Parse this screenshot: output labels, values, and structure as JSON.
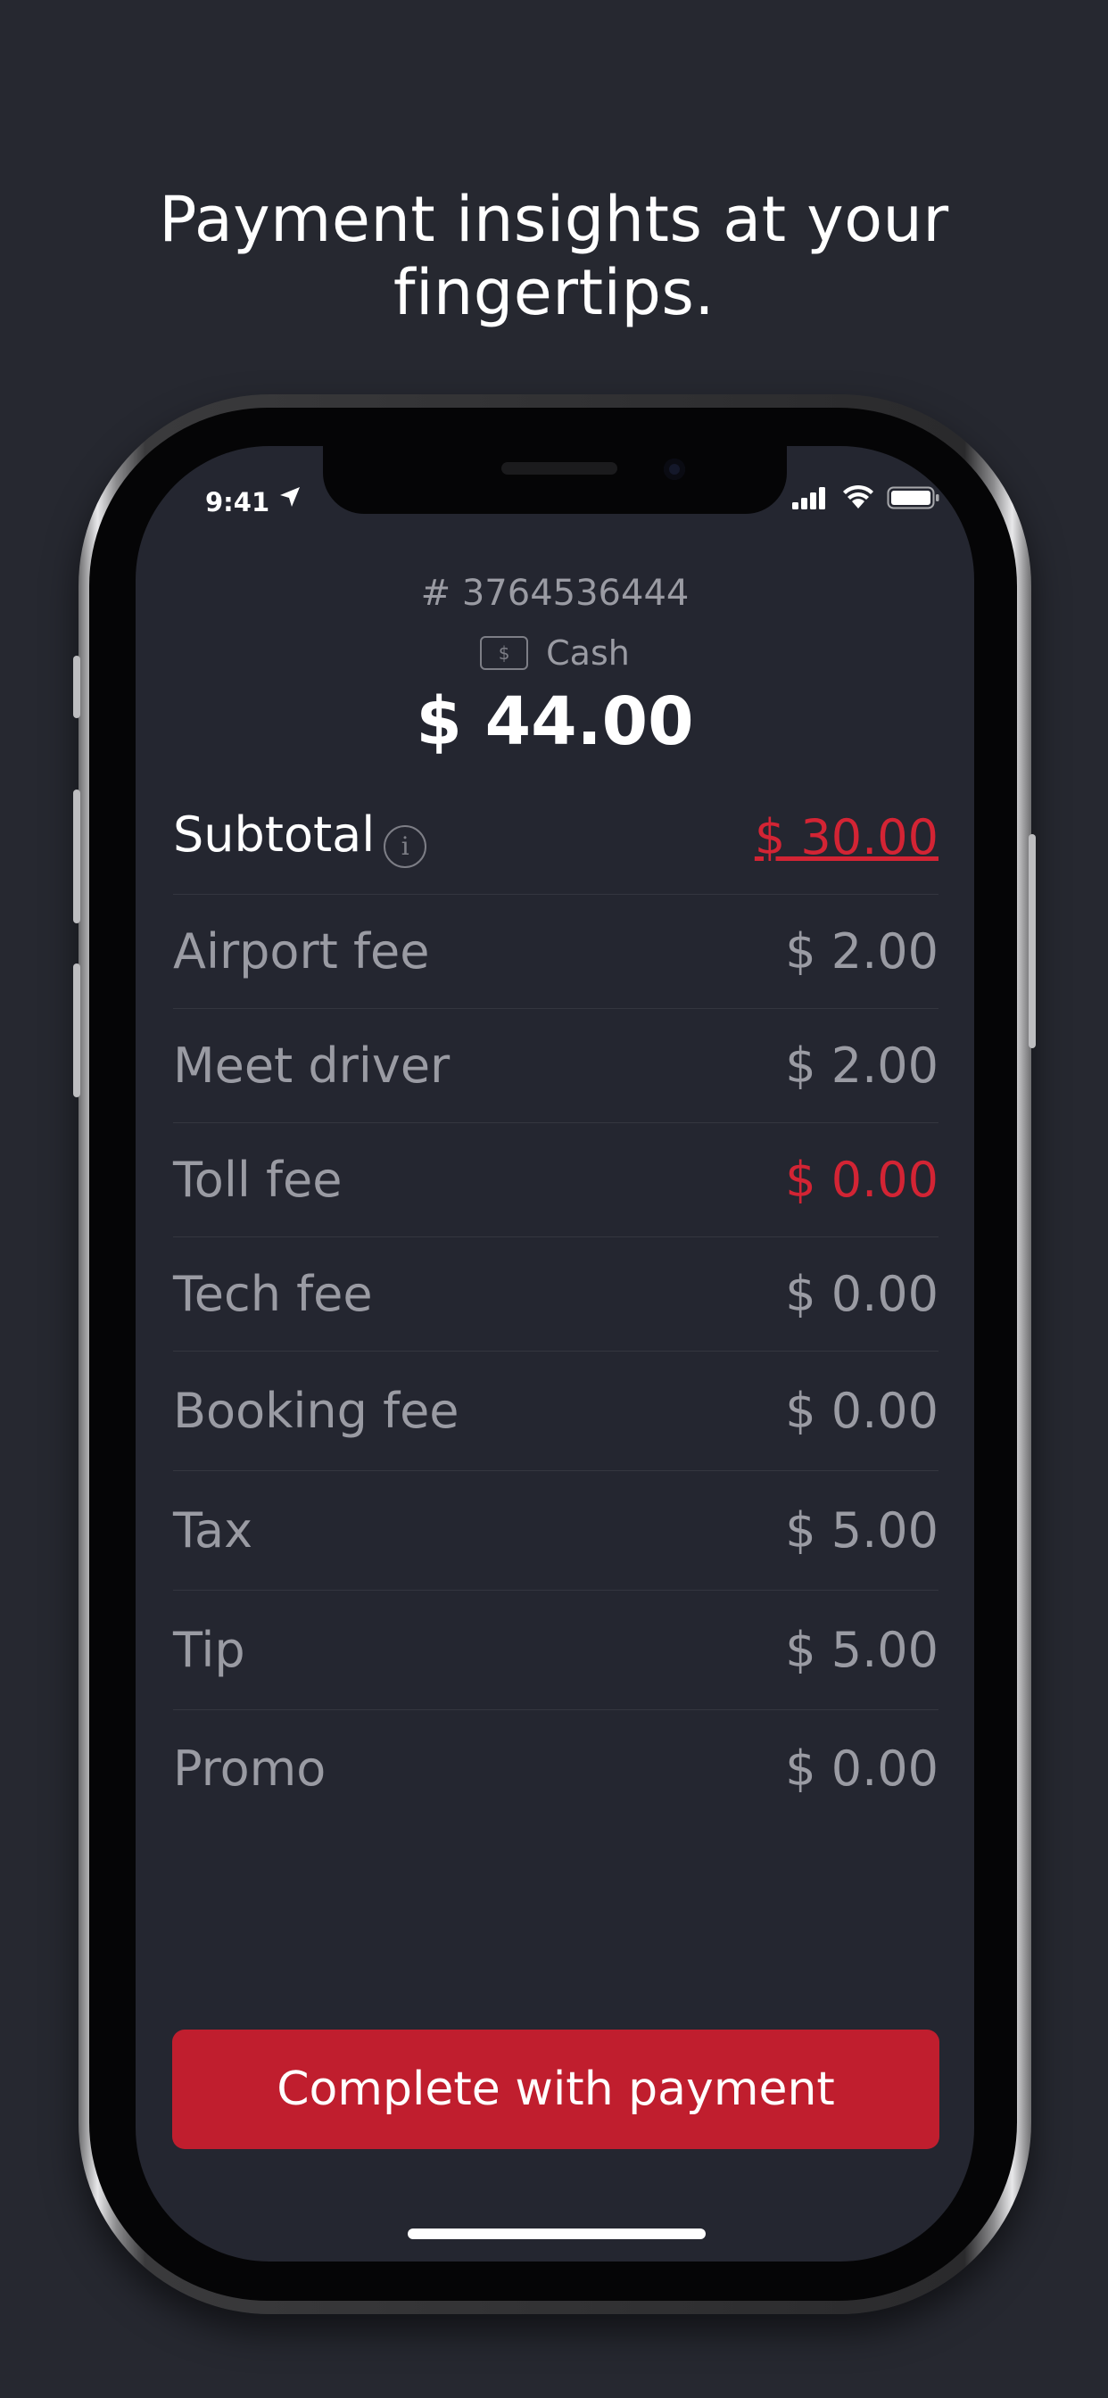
{
  "headline": "Payment insights at your fingertips.",
  "status_bar": {
    "time": "9:41",
    "icons": [
      "location-arrow-icon",
      "cellular-signal-icon",
      "wifi-icon",
      "battery-icon"
    ]
  },
  "order": {
    "id": "# 3764536444",
    "payment_method_icon_text": "$",
    "payment_method": "Cash",
    "total": "$ 44.00"
  },
  "breakdown": [
    {
      "label": "Subtotal",
      "value": "$ 30.00",
      "style": "link"
    },
    {
      "label": "Airport fee",
      "value": "$ 2.00",
      "style": "normal"
    },
    {
      "label": "Meet driver",
      "value": "$ 2.00",
      "style": "normal"
    },
    {
      "label": "Toll fee",
      "value": "$ 0.00",
      "style": "red"
    },
    {
      "label": "Tech fee",
      "value": "$ 0.00",
      "style": "normal"
    },
    {
      "label": "Booking fee",
      "value": "$ 0.00",
      "style": "normal"
    },
    {
      "label": "Tax",
      "value": "$ 5.00",
      "style": "normal"
    },
    {
      "label": "Tip",
      "value": "$ 5.00",
      "style": "normal"
    },
    {
      "label": "Promo",
      "value": "$ 0.00",
      "style": "normal"
    }
  ],
  "info_icon_text": "i",
  "complete_button": "Complete with payment",
  "colors": {
    "background": "#262830",
    "screen": "#242630",
    "accent_red": "#c01e2e",
    "muted_text": "#9a9ba3"
  }
}
